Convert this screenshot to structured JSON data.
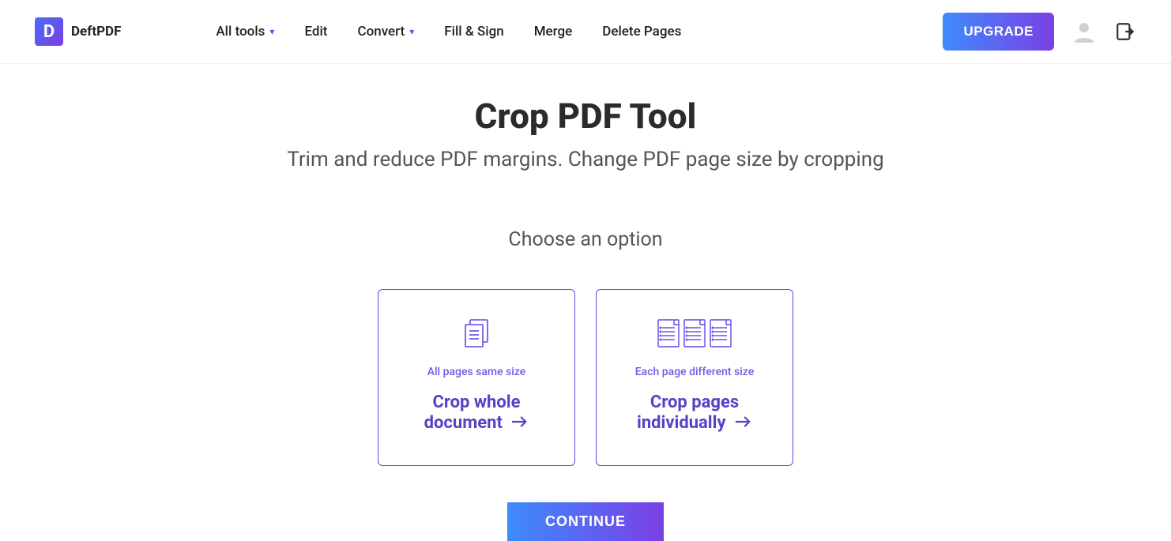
{
  "brand": {
    "mark": "D",
    "name": "DeftPDF"
  },
  "nav": {
    "all_tools": "All tools",
    "edit": "Edit",
    "convert": "Convert",
    "fill_sign": "Fill & Sign",
    "merge": "Merge",
    "delete_pages": "Delete Pages"
  },
  "header": {
    "upgrade": "UPGRADE"
  },
  "page": {
    "title": "Crop PDF Tool",
    "subtitle": "Trim and reduce PDF margins. Change PDF page size by cropping",
    "choose": "Choose an option"
  },
  "options": {
    "whole": {
      "sub": "All pages same size",
      "title_l1": "Crop whole",
      "title_l2": "document"
    },
    "individual": {
      "sub": "Each page different size",
      "title_l1": "Crop pages",
      "title_l2": "individually"
    }
  },
  "actions": {
    "continue": "CONTINUE"
  }
}
